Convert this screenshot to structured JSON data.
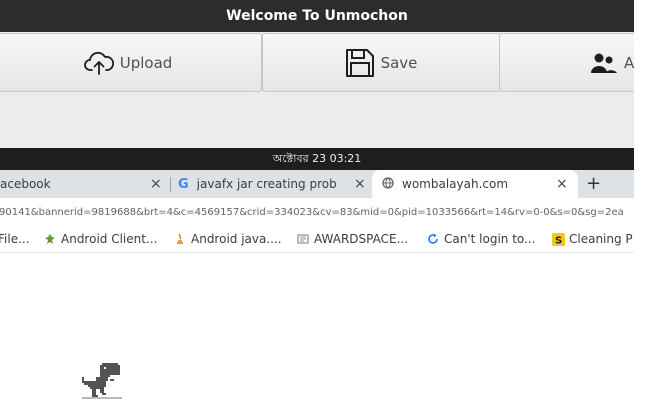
{
  "window": {
    "title": "Welcome To Unmochon"
  },
  "toolbar": {
    "upload_label": "Upload",
    "save_label": "Save",
    "third_label": "A",
    "icons": [
      "cloud-upload-icon",
      "floppy-disk-icon",
      "users-icon"
    ]
  },
  "system_bar": {
    "datetime": "অক্টোবর 23  03:21"
  },
  "browser": {
    "tabs": [
      {
        "label": "acebook",
        "active": false
      },
      {
        "label": "javafx jar creating proble",
        "active": false
      },
      {
        "label": "wombalayah.com",
        "active": true
      }
    ],
    "url": "90141&bannerid=9819688&brt=4&c=4569157&crid=334023&cv=83&mid=0&pid=1033566&rt=14&rv=0-0&s=0&sg=2ea",
    "bookmarks": [
      {
        "label": "File..."
      },
      {
        "label": "Android Client..."
      },
      {
        "label": "Android java...."
      },
      {
        "label": "AWARDSPACE..."
      },
      {
        "label": "Can't login to..."
      },
      {
        "label": "Cleaning P"
      }
    ]
  },
  "colors": {
    "titlebar": "#2c2c2c",
    "system_bar": "#1e1e1e",
    "toolbar": "#ececec",
    "tabstrip": "#dee1e6",
    "google_blue": "#4285f4"
  }
}
